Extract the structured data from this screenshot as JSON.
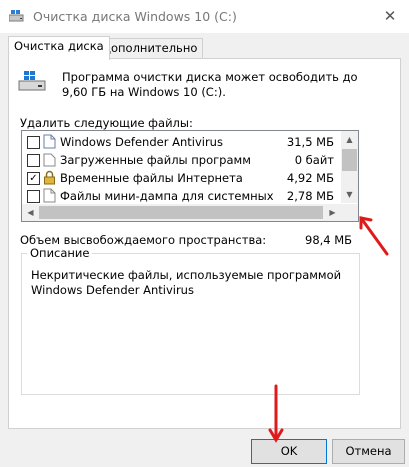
{
  "window": {
    "title": "Очистка диска Windows 10 (C:)",
    "close_icon": "close-icon"
  },
  "tabs": [
    {
      "label": "Очистка диска",
      "active": true
    },
    {
      "label": "Дополнительно",
      "active": false
    }
  ],
  "intro_text": "Программа очистки диска может освободить до 9,60 ГБ на Windows 10 (C:).",
  "files_label": "Удалить следующие файлы:",
  "files": [
    {
      "name": "Windows Defender Antivirus",
      "size": "31,5 МБ",
      "checked": false,
      "icon": "file-icon"
    },
    {
      "name": "Загруженные файлы программ",
      "size": "0 байт",
      "checked": false,
      "icon": "folder-icon"
    },
    {
      "name": "Временные файлы Интернета",
      "size": "4,92 МБ",
      "checked": true,
      "icon": "lock-icon"
    },
    {
      "name": "Файлы мини-дампа для системных",
      "size": "2,78 МБ",
      "checked": false,
      "icon": "file-icon"
    }
  ],
  "space_label": "Объем высвобождаемого пространства:",
  "space_value": "98,4 МБ",
  "description": {
    "title": "Описание",
    "text": "Некритические файлы, используемые программой Windows Defender Antivirus"
  },
  "buttons": {
    "ok": "OK",
    "cancel": "Отмена"
  },
  "colors": {
    "arrow": "#e01a1a",
    "ok_border": "#0078d7",
    "checkbox_check": "#000000"
  }
}
